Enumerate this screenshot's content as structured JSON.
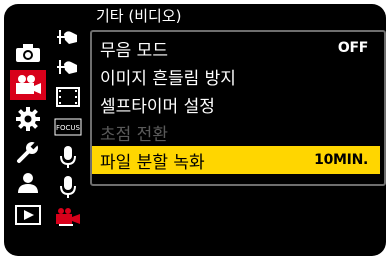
{
  "header": {
    "title": "기타 (비디오)"
  },
  "tabs": [
    {
      "icon": "camera-icon"
    },
    {
      "icon": "video-camera-icon",
      "active": true
    },
    {
      "icon": "gear-icon"
    },
    {
      "icon": "wrench-icon"
    },
    {
      "icon": "user-icon"
    },
    {
      "icon": "playback-icon"
    }
  ],
  "subtabs": [
    {
      "icon": "ibis-hand-icon-1"
    },
    {
      "icon": "ibis-hand-icon-2"
    },
    {
      "icon": "film-icon"
    },
    {
      "icon": "focus-icon",
      "label": "FOCUS"
    },
    {
      "icon": "mic-icon-1"
    },
    {
      "icon": "mic-icon-2"
    },
    {
      "icon": "video-red-icon",
      "active": true
    }
  ],
  "menu": {
    "items": [
      {
        "label": "무음 모드",
        "value": "OFF",
        "state": "normal"
      },
      {
        "label": "이미지 흔들림 방지",
        "value": "",
        "state": "normal"
      },
      {
        "label": "셀프타이머 설정",
        "value": "",
        "state": "normal"
      },
      {
        "label": "초점 전환",
        "value": "",
        "state": "disabled"
      },
      {
        "label": "파일 분할 녹화",
        "value": "10MIN.",
        "state": "selected"
      }
    ]
  },
  "colors": {
    "accent_red": "#d8001a",
    "highlight_yellow": "#ffd600",
    "frame_gray": "#6e6e6e"
  }
}
